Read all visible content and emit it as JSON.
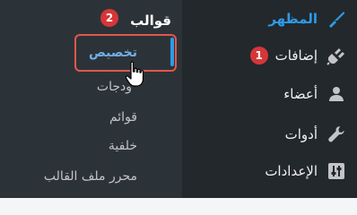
{
  "sidebar": {
    "items": [
      {
        "label": "المظهر",
        "icon": "appearance-brush-icon",
        "active": true
      },
      {
        "label": "إضافات",
        "icon": "plugins-plug-icon",
        "badge": "1"
      },
      {
        "label": "أعضاء",
        "icon": "users-person-icon"
      },
      {
        "label": "أدوات",
        "icon": "tools-wrench-icon"
      },
      {
        "label": "الإعدادات",
        "icon": "settings-sliders-icon"
      }
    ]
  },
  "submenu": {
    "title": "قوالب",
    "title_badge": "2",
    "items": [
      {
        "label": "تخصيص"
      },
      {
        "label": "ودجات"
      },
      {
        "label": "قوائم"
      },
      {
        "label": "خلفية"
      },
      {
        "label": "محرر ملف القالب"
      }
    ]
  },
  "colors": {
    "sidebar_bg": "#23282d",
    "submenu_bg": "#2c3338",
    "accent_blue": "#2d9be8",
    "badge_red": "#d63638",
    "highlight_outline": "#e2574c"
  }
}
